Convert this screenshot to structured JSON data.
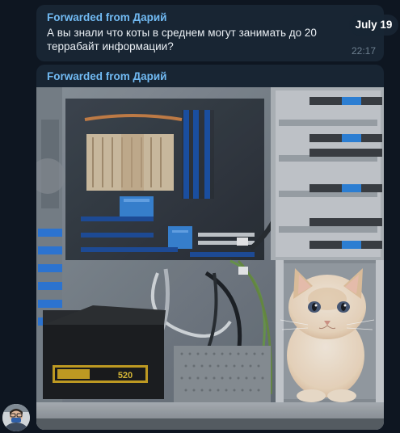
{
  "date_pill": "July 19",
  "message1": {
    "forwarded_from": "Forwarded from Дарий",
    "text": "А вы знали что коты в среднем могут занимать до 20 террабайт информации?",
    "time": "22:17"
  },
  "message2": {
    "forwarded_from": "Forwarded from Дарий",
    "photo_psu_label": "520"
  },
  "colors": {
    "background": "#0e1621",
    "bubble": "#182533",
    "accent_name": "#71baf3",
    "time": "#6d7f8f"
  }
}
